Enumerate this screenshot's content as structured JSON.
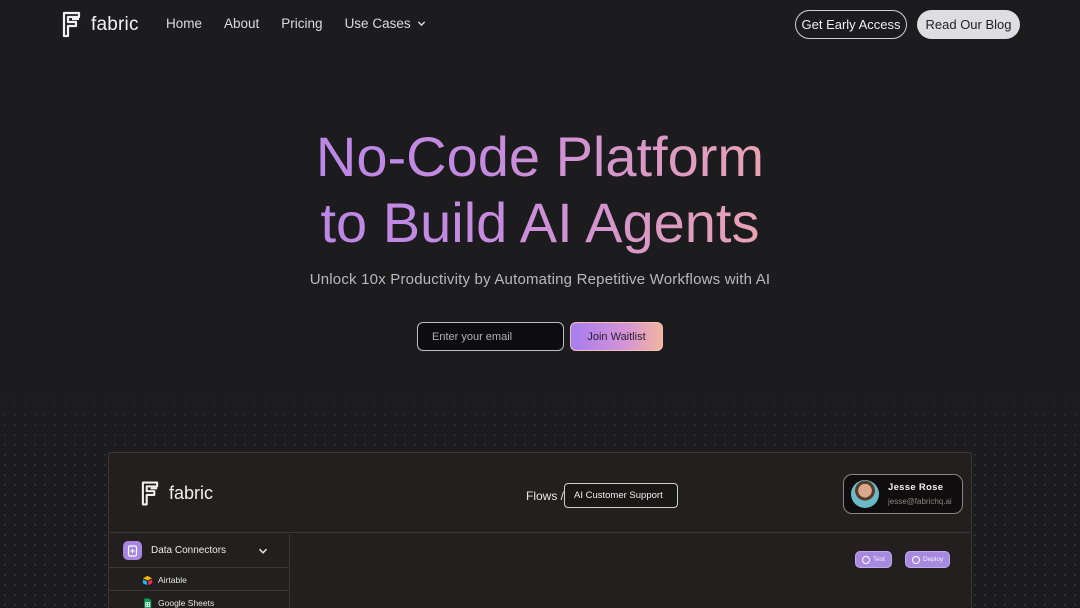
{
  "nav": {
    "brand": "fabric",
    "links": [
      {
        "label": "Home"
      },
      {
        "label": "About"
      },
      {
        "label": "Pricing"
      },
      {
        "label": "Use Cases"
      }
    ],
    "cta_outline": "Get Early Access",
    "cta_solid": "Read Our Blog"
  },
  "hero": {
    "title_line1": "No-Code Platform",
    "title_line2": "to Build AI Agents",
    "subtitle": "Unlock 10x Productivity by Automating Repetitive Workflows with AI",
    "email_placeholder": "Enter your email",
    "join_label": "Join Waitlist"
  },
  "preview": {
    "brand": "fabric",
    "flows_label": "Flows /",
    "flow_name": "AI Customer Support",
    "user": {
      "name": "Jesse Rose",
      "email": "jesse@fabrichq.ai"
    },
    "sidebar": {
      "section_label": "Data Connectors",
      "items": [
        {
          "label": "Airtable",
          "icon": "airtable-icon"
        },
        {
          "label": "Google Sheets",
          "icon": "google-sheets-icon"
        }
      ]
    },
    "actions": {
      "test_label": "Test",
      "deploy_label": "Deploy"
    }
  },
  "colors": {
    "background": "#1c1c1f",
    "accent_purple": "#a97ff0",
    "accent_peach": "#f0b19c"
  }
}
